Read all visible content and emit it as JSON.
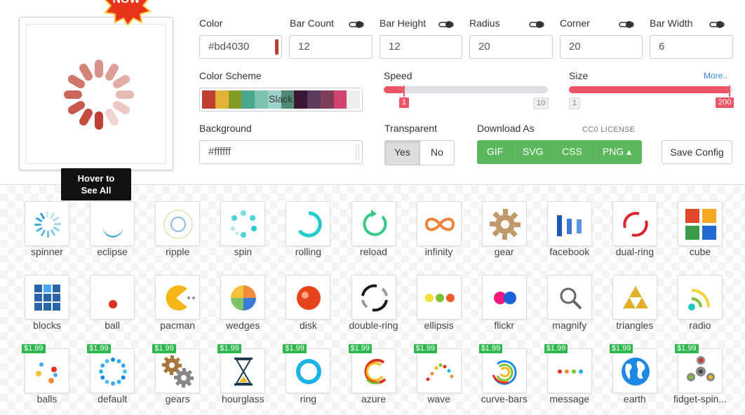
{
  "badge": "NOW",
  "hover_tip": {
    "line1": "Hover to",
    "line2": "See All"
  },
  "fields": {
    "color": {
      "label": "Color",
      "value": "#bd4030"
    },
    "bar_count": {
      "label": "Bar Count",
      "value": "12"
    },
    "bar_height": {
      "label": "Bar Height",
      "value": "12"
    },
    "radius": {
      "label": "Radius",
      "value": "20"
    },
    "corner": {
      "label": "Corner",
      "value": "20"
    },
    "bar_width": {
      "label": "Bar Width",
      "value": "6"
    }
  },
  "color_scheme": {
    "label": "Color Scheme",
    "name": "Slack",
    "colors": [
      "#bd4030",
      "#e0b236",
      "#849b24",
      "#4aa68c",
      "#7ec3b0",
      "#9dd2cc",
      "#4e8a74",
      "#3b1736",
      "#5b3a5e",
      "#7e3d58",
      "#d1446d",
      "#eeeeee"
    ]
  },
  "speed": {
    "label": "Speed",
    "value": 1,
    "min": 1,
    "max": 10,
    "value_label": "1",
    "max_label": "10"
  },
  "size": {
    "label": "Size",
    "value": 200,
    "min": 1,
    "max": 200,
    "value_label": "200",
    "min_label": "1",
    "more_link": "More.."
  },
  "background": {
    "label": "Background",
    "value": "#ffffff"
  },
  "transparent": {
    "label": "Transparent",
    "yes": "Yes",
    "no": "No",
    "selected": "Yes"
  },
  "download": {
    "label": "Download As",
    "license": "CC0 LICENSE",
    "formats": [
      "GIF",
      "SVG",
      "CSS",
      "PNG ▴"
    ]
  },
  "save_config": "Save Config",
  "gallery": [
    {
      "name": "spinner",
      "icon": "spinner-icon",
      "price": ""
    },
    {
      "name": "eclipse",
      "icon": "eclipse-icon",
      "price": ""
    },
    {
      "name": "ripple",
      "icon": "ripple-icon",
      "price": ""
    },
    {
      "name": "spin",
      "icon": "spin-icon",
      "price": ""
    },
    {
      "name": "rolling",
      "icon": "rolling-icon",
      "price": ""
    },
    {
      "name": "reload",
      "icon": "reload-icon",
      "price": ""
    },
    {
      "name": "infinity",
      "icon": "infinity-icon",
      "price": ""
    },
    {
      "name": "gear",
      "icon": "gear-icon",
      "price": ""
    },
    {
      "name": "facebook",
      "icon": "facebook-icon",
      "price": ""
    },
    {
      "name": "dual-ring",
      "icon": "dual-ring-icon",
      "price": ""
    },
    {
      "name": "cube",
      "icon": "cube-icon",
      "price": ""
    },
    {
      "name": "blocks",
      "icon": "blocks-icon",
      "price": ""
    },
    {
      "name": "ball",
      "icon": "ball-icon",
      "price": ""
    },
    {
      "name": "pacman",
      "icon": "pacman-icon",
      "price": ""
    },
    {
      "name": "wedges",
      "icon": "wedges-icon",
      "price": ""
    },
    {
      "name": "disk",
      "icon": "disk-icon",
      "price": ""
    },
    {
      "name": "double-ring",
      "icon": "double-ring-icon",
      "price": ""
    },
    {
      "name": "ellipsis",
      "icon": "ellipsis-icon",
      "price": ""
    },
    {
      "name": "flickr",
      "icon": "flickr-icon",
      "price": ""
    },
    {
      "name": "magnify",
      "icon": "magnify-icon",
      "price": ""
    },
    {
      "name": "triangles",
      "icon": "triangles-icon",
      "price": ""
    },
    {
      "name": "radio",
      "icon": "radio-icon",
      "price": ""
    },
    {
      "name": "balls",
      "icon": "balls-icon",
      "price": "$1.99"
    },
    {
      "name": "default",
      "icon": "default-icon",
      "price": "$1.99"
    },
    {
      "name": "gears",
      "icon": "gears-icon",
      "price": "$1.99"
    },
    {
      "name": "hourglass",
      "icon": "hourglass-icon",
      "price": "$1.99"
    },
    {
      "name": "ring",
      "icon": "ring-icon",
      "price": "$1.99"
    },
    {
      "name": "azure",
      "icon": "azure-icon",
      "price": "$1.99"
    },
    {
      "name": "wave",
      "icon": "wave-icon",
      "price": "$1.99"
    },
    {
      "name": "curve-bars",
      "icon": "curve-bars-icon",
      "price": "$1.99"
    },
    {
      "name": "message",
      "icon": "message-icon",
      "price": "$1.99"
    },
    {
      "name": "earth",
      "icon": "earth-icon",
      "price": "$1.99"
    },
    {
      "name": "fidget-spin...",
      "icon": "fidget-spinner-icon",
      "price": "$1.99"
    }
  ]
}
